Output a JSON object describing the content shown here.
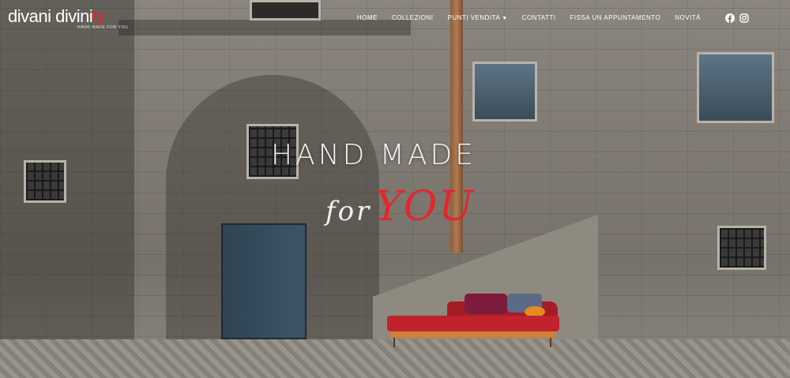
{
  "logo": {
    "main": "divani divini",
    "accent": "ty",
    "tagline": "HAND MADE FOR YOU"
  },
  "nav": {
    "items": [
      {
        "label": "HOME"
      },
      {
        "label": "COLLEZIONI"
      },
      {
        "label": "PUNTI VENDITA"
      },
      {
        "label": "CONTATTI"
      },
      {
        "label": "FISSA UN APPUNTAMENTO"
      },
      {
        "label": "NOVITÀ"
      }
    ],
    "dropdown_icon": "chevron-down-icon",
    "social": [
      "facebook-icon",
      "instagram-icon"
    ]
  },
  "hero": {
    "headline": "HAND MADE",
    "script_for": "for",
    "script_you": "YOU"
  },
  "colors": {
    "accent": "#e3262d",
    "text": "#ffffff"
  }
}
